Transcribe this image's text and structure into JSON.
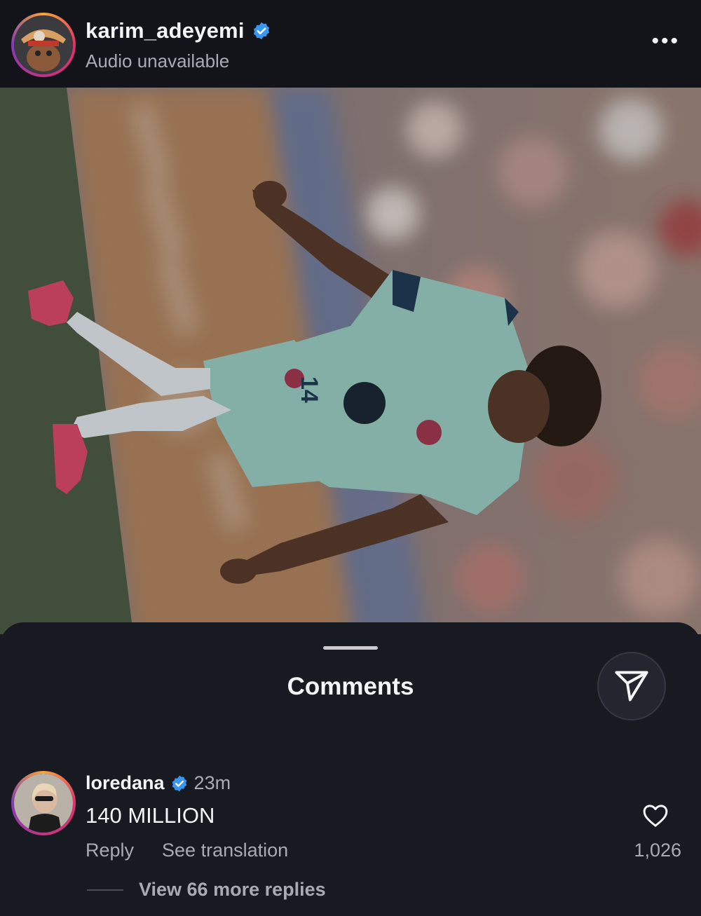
{
  "header": {
    "username": "karim_adeyemi",
    "subtitle": "Audio unavailable",
    "more_icon": "more-horizontal-icon"
  },
  "post": {
    "shirt_number": "14"
  },
  "comments_sheet": {
    "title": "Comments",
    "share_icon": "send-icon"
  },
  "comment": {
    "username": "loredana",
    "time": "23m",
    "text": "140 MILLION",
    "reply_label": "Reply",
    "translate_label": "See translation",
    "like_count": "1,026",
    "view_replies": "View 66 more replies"
  },
  "colors": {
    "background": "#181a21",
    "verified": "#3897f0",
    "muted_text": "#a8abb3",
    "jersey": "#9fd2c7",
    "boots": "#e24a6a"
  }
}
